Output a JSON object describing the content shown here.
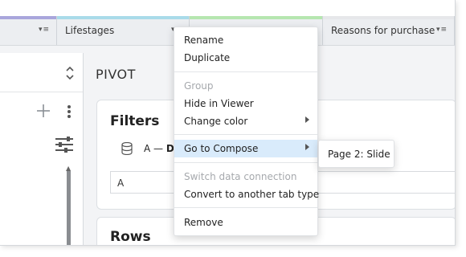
{
  "colors": {
    "tab_strip_1": "#a9a6dc",
    "tab_strip_2": "#a9dbe9",
    "tab_strip_3": "#b6e6b0",
    "tab_strip_4": "#e6e7ea",
    "menu_highlight": "#d9ebfb"
  },
  "tabs": [
    {
      "label": "",
      "menu_icon": "dropdown-menu-icon"
    },
    {
      "label": "Lifestages",
      "menu_icon": "dropdown-menu-icon"
    },
    {
      "label": "",
      "menu_icon": "dropdown-menu-icon"
    },
    {
      "label": "Reasons for purchase",
      "menu_icon": "dropdown-menu-icon"
    }
  ],
  "tab_menu_glyph": "▾≡",
  "left_panel": {
    "icons": [
      "updown-chevron-icon",
      "plus-icon",
      "kebab-icon",
      "sliders-icon"
    ]
  },
  "main": {
    "title": "PIVOT",
    "filters": {
      "heading": "Filters",
      "datasource_prefix": "A",
      "datasource_sep": "—",
      "datasource_name": "D",
      "input_value": "A"
    },
    "rows": {
      "heading": "Rows"
    }
  },
  "context_menu": {
    "items": [
      {
        "label": "Rename",
        "disabled": false,
        "submenu": false
      },
      {
        "label": "Duplicate",
        "disabled": false,
        "submenu": false
      },
      {
        "label": "Group",
        "disabled": true,
        "submenu": false
      },
      {
        "label": "Hide in Viewer",
        "disabled": false,
        "submenu": false
      },
      {
        "label": "Change color",
        "disabled": false,
        "submenu": true
      },
      {
        "label": "Go to Compose",
        "disabled": false,
        "submenu": true,
        "highlighted": true
      },
      {
        "label": "Switch data connection",
        "disabled": true,
        "submenu": false
      },
      {
        "label": "Convert to another tab type",
        "disabled": false,
        "submenu": false
      },
      {
        "label": "Remove",
        "disabled": false,
        "submenu": false
      }
    ],
    "submenu": {
      "items": [
        {
          "label": "Page 2: Slide"
        }
      ]
    }
  }
}
